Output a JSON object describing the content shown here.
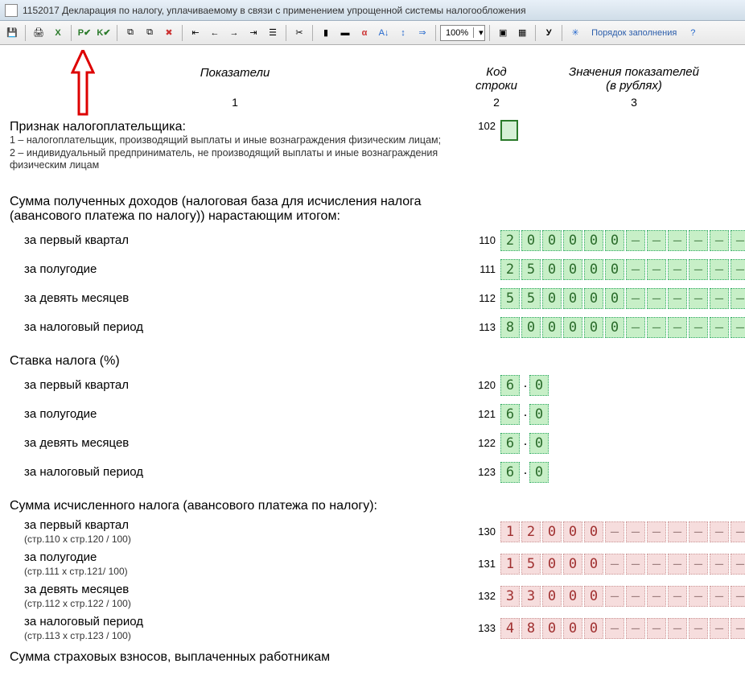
{
  "window": {
    "title": "1152017 Декларация по налогу, уплачиваемому в связи с применением упрощенной системы налогообложения",
    "zoom": "100%",
    "order_label": "Порядок заполнения"
  },
  "headers": {
    "col1": "Показатели",
    "col2_l1": "Код",
    "col2_l2": "строки",
    "col3_l1": "Значения показателей",
    "col3_l2": "(в рублях)",
    "n1": "1",
    "n2": "2",
    "n3": "3"
  },
  "s102": {
    "title": "Признак налогоплательщика:",
    "note1": "1 – налогоплательщик, производящий выплаты и иные вознаграждения физическим лицам;",
    "note2": "2 – индивидуальный предприниматель, не производящий выплаты и иные вознаграждения физическим лицам",
    "code": "102"
  },
  "income": {
    "title": "Сумма полученных доходов (налоговая база для исчисления налога (авансового платежа по налогу)) нарастающим итогом:",
    "r110": {
      "label": "за первый квартал",
      "code": "110",
      "cells": [
        "2",
        "0",
        "0",
        "0",
        "0",
        "0",
        "–",
        "–",
        "–",
        "–",
        "–",
        "–"
      ]
    },
    "r111": {
      "label": "за полугодие",
      "code": "111",
      "cells": [
        "2",
        "5",
        "0",
        "0",
        "0",
        "0",
        "–",
        "–",
        "–",
        "–",
        "–",
        "–"
      ]
    },
    "r112": {
      "label": "за девять месяцев",
      "code": "112",
      "cells": [
        "5",
        "5",
        "0",
        "0",
        "0",
        "0",
        "–",
        "–",
        "–",
        "–",
        "–",
        "–"
      ]
    },
    "r113": {
      "label": "за налоговый период",
      "code": "113",
      "cells": [
        "8",
        "0",
        "0",
        "0",
        "0",
        "0",
        "–",
        "–",
        "–",
        "–",
        "–",
        "–"
      ]
    }
  },
  "rate": {
    "title": "Ставка налога (%)",
    "r120": {
      "label": "за первый квартал",
      "code": "120",
      "a": "6",
      "b": "0"
    },
    "r121": {
      "label": "за полугодие",
      "code": "121",
      "a": "6",
      "b": "0"
    },
    "r122": {
      "label": "за девять месяцев",
      "code": "122",
      "a": "6",
      "b": "0"
    },
    "r123": {
      "label": "за налоговый период",
      "code": "123",
      "a": "6",
      "b": "0"
    }
  },
  "calc": {
    "title": "Сумма исчисленного налога (авансового платежа по налогу):",
    "r130": {
      "label": "за первый квартал",
      "sub": "(стр.110 x стр.120 / 100)",
      "code": "130",
      "cells": [
        "1",
        "2",
        "0",
        "0",
        "0",
        "–",
        "–",
        "–",
        "–",
        "–",
        "–",
        "–"
      ]
    },
    "r131": {
      "label": "за полугодие",
      "sub": "(стр.111 x стр.121/ 100)",
      "code": "131",
      "cells": [
        "1",
        "5",
        "0",
        "0",
        "0",
        "–",
        "–",
        "–",
        "–",
        "–",
        "–",
        "–"
      ]
    },
    "r132": {
      "label": "за девять месяцев",
      "sub": "(стр.112 x стр.122 / 100)",
      "code": "132",
      "cells": [
        "3",
        "3",
        "0",
        "0",
        "0",
        "–",
        "–",
        "–",
        "–",
        "–",
        "–",
        "–"
      ]
    },
    "r133": {
      "label": "за налоговый период",
      "sub": "(стр.113 x стр.123 / 100)",
      "code": "133",
      "cells": [
        "4",
        "8",
        "0",
        "0",
        "0",
        "–",
        "–",
        "–",
        "–",
        "–",
        "–",
        "–"
      ]
    }
  },
  "footer_title": "Сумма страховых взносов, выплаченных работникам"
}
